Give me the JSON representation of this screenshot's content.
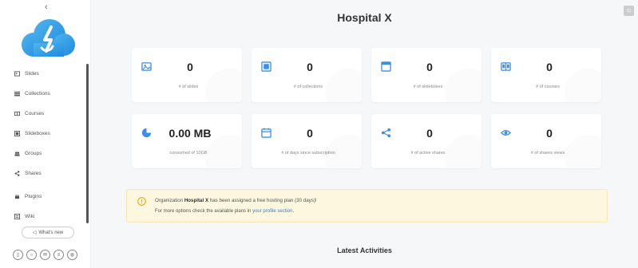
{
  "sidebar": {
    "collapse_icon": "‹",
    "items": [
      {
        "label": "Slides",
        "icon": "slides-icon"
      },
      {
        "label": "Collections",
        "icon": "collections-icon"
      },
      {
        "label": "Courses",
        "icon": "courses-icon"
      },
      {
        "label": "Slideboxes",
        "icon": "slideboxes-icon"
      },
      {
        "label": "Groups",
        "icon": "groups-icon"
      },
      {
        "label": "Shares",
        "icon": "shares-icon"
      },
      {
        "label": "Plugins",
        "icon": "plugins-icon"
      },
      {
        "label": "Wiki",
        "icon": "wiki-icon"
      }
    ],
    "whats_new_label": "What's new"
  },
  "header": {
    "title": "Hospital X"
  },
  "stats": [
    {
      "value": "0",
      "label": "# of slides",
      "icon": "image-icon"
    },
    {
      "value": "0",
      "label": "# of collections",
      "icon": "collections-icon"
    },
    {
      "value": "0",
      "label": "# of slideboxes",
      "icon": "slidebox-icon"
    },
    {
      "value": "0",
      "label": "# of courses",
      "icon": "courses-icon"
    },
    {
      "value": "0.00 MB",
      "label": "consumed of 10GB",
      "icon": "pie-chart-icon"
    },
    {
      "value": "0",
      "label": "# of days since subscription",
      "icon": "calendar-icon"
    },
    {
      "value": "0",
      "label": "# of active shares",
      "icon": "share-icon"
    },
    {
      "value": "0",
      "label": "# of shares views",
      "icon": "eye-icon"
    }
  ],
  "alert": {
    "pre": "Organization ",
    "org": "Hospital X",
    "post": " has been assigned a free hosting plan (30 days)!",
    "line2_pre": "For more options check the available plans in ",
    "line2_link": "your profile section",
    "line2_post": "."
  },
  "activities": {
    "title": "Latest Activities"
  },
  "colors": {
    "accent": "#3a8ee6",
    "warning": "#f0a500",
    "alert_bg": "#fdf7e0"
  }
}
